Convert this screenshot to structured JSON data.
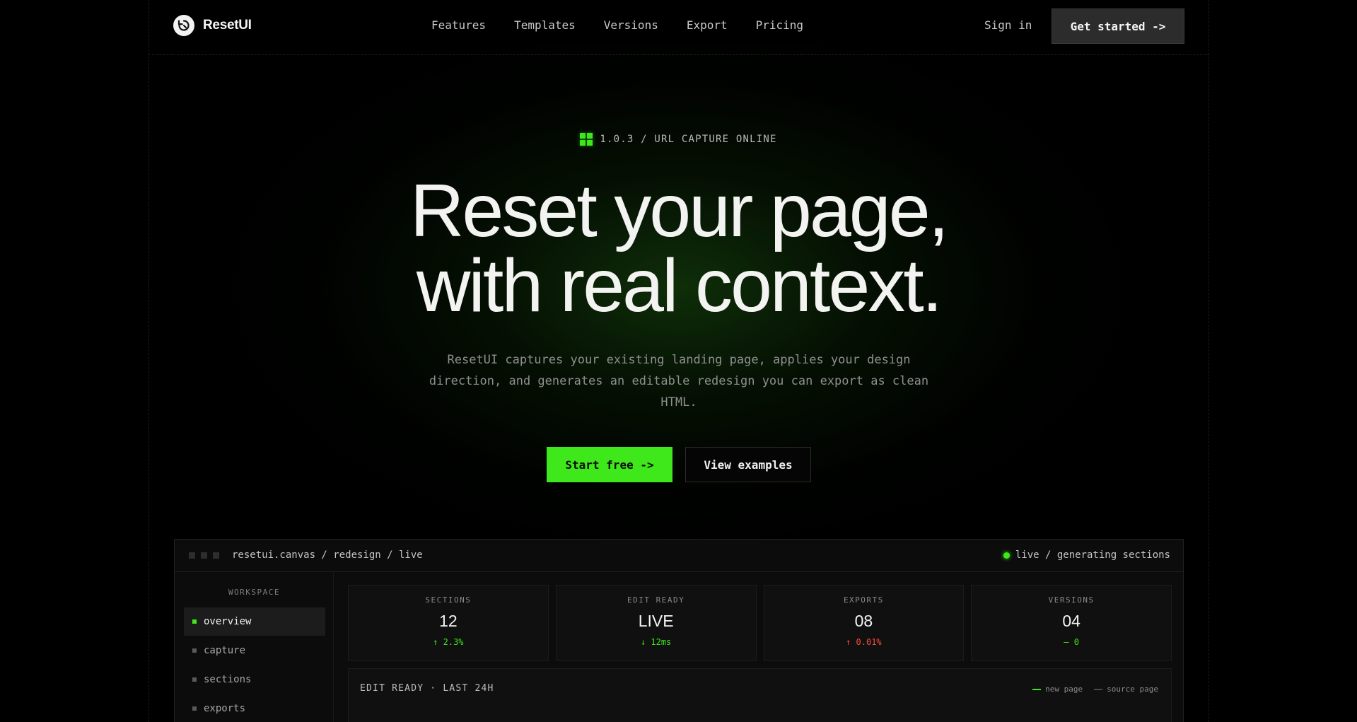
{
  "colors": {
    "accent": "#3ee81a",
    "background": "#000000",
    "danger": "#ff4d3d"
  },
  "nav": {
    "brand": "ResetUI",
    "logo_icon": "reset-arrow-icon",
    "links": [
      "Features",
      "Templates",
      "Versions",
      "Export",
      "Pricing"
    ],
    "signin": "Sign in",
    "cta": "Get started ->"
  },
  "hero": {
    "badge_icon": "grid-icon",
    "badge": "1.0.3 / URL CAPTURE ONLINE",
    "headline_line1": "Reset your page,",
    "headline_line2": "with real context.",
    "subtext": "ResetUI captures your existing landing page, applies your design direction, and generates an editable redesign you can export as clean HTML.",
    "primary_cta": "Start free ->",
    "secondary_cta": "View examples"
  },
  "app": {
    "path": "resetui.canvas / redesign / live",
    "status": "live / generating sections",
    "sidebar": {
      "label": "WORKSPACE",
      "items": [
        {
          "label": "overview",
          "active": true
        },
        {
          "label": "capture",
          "active": false
        },
        {
          "label": "sections",
          "active": false
        },
        {
          "label": "exports",
          "active": false
        }
      ]
    },
    "stats": [
      {
        "label": "SECTIONS",
        "value": "12",
        "delta": "↑ 2.3%",
        "trend": "up"
      },
      {
        "label": "EDIT READY",
        "value": "LIVE",
        "delta": "↓ 12ms",
        "trend": "up"
      },
      {
        "label": "EXPORTS",
        "value": "08",
        "delta": "↑ 0.01%",
        "trend": "down"
      },
      {
        "label": "VERSIONS",
        "value": "04",
        "delta": "— 0",
        "trend": "up"
      }
    ],
    "chart": {
      "title": "EDIT READY · LAST 24H",
      "legend": [
        {
          "label": "new page",
          "color": "#3ee81a"
        },
        {
          "label": "source page",
          "color": "#4a4a4a"
        }
      ]
    }
  }
}
